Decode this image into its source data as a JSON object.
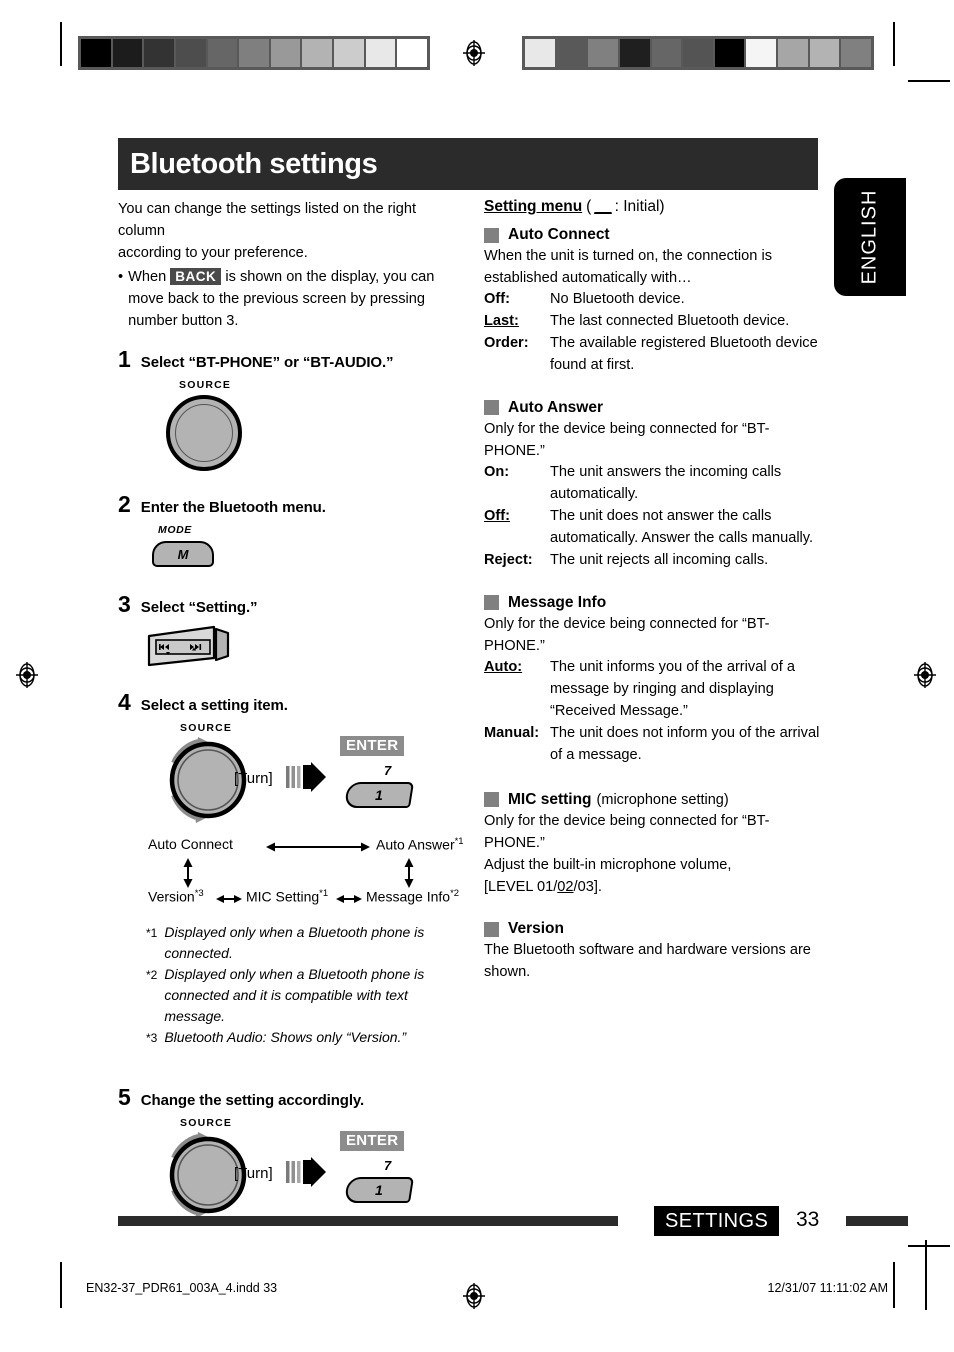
{
  "language_tab": {
    "label": "ENGLISH"
  },
  "page_title": "Bluetooth settings",
  "intro": {
    "line1": "You can change the settings listed on the right column",
    "line2": "according to your preference.",
    "bullet_dot": "•",
    "bullet_pre": "When",
    "bullet_badge": "BACK",
    "bullet_post": "is shown on the display, you can move back to the previous screen by pressing number button 3."
  },
  "steps": [
    {
      "num": "1",
      "text": "Select “BT-PHONE” or “BT-AUDIO.”"
    },
    {
      "num": "2",
      "text": "Enter the Bluetooth menu."
    },
    {
      "num": "3",
      "text": "Select “Setting.”"
    },
    {
      "num": "4",
      "text": "Select a setting item."
    },
    {
      "num": "5",
      "text": "Change the setting accordingly."
    }
  ],
  "controls": {
    "source_label": "SOURCE",
    "mode_label": "MODE",
    "mode_button": "M",
    "turn_label": "[Turn]",
    "enter_badge": "ENTER",
    "number_key": "1",
    "number_key_sup": "7",
    "track_prev_icon": "track-previous-icon",
    "track_next_icon": "track-next-icon"
  },
  "flow": {
    "item1": "Auto Connect",
    "item2": "Auto Answer",
    "item2_sup": "*1",
    "item3": "Message Info",
    "item3_sup": "*2",
    "item4": "MIC Setting",
    "item4_sup": "*1",
    "item5": "Version",
    "item5_sup": "*3"
  },
  "footnotes": [
    {
      "mark": "*1",
      "text": "Displayed only when a Bluetooth phone is connected."
    },
    {
      "mark": "*2",
      "text": "Displayed only when a Bluetooth phone is connected and it is compatible with text message."
    },
    {
      "mark": "*3",
      "text": "Bluetooth Audio: Shows only “Version.”"
    }
  ],
  "setting_menu": {
    "heading": "Setting menu",
    "heading_note_open": "(",
    "heading_note_underline": "__",
    "heading_note_rest": ": Initial)"
  },
  "sections": [
    {
      "name": "Auto Connect",
      "paren": "",
      "intro": "When the unit is turned on, the connection is established automatically with…",
      "options": [
        {
          "key": "Off:",
          "initial": false,
          "desc": "No Bluetooth device."
        },
        {
          "key": "Last:",
          "initial": true,
          "desc": "The last connected Bluetooth device."
        },
        {
          "key": "Order:",
          "initial": false,
          "desc": "The available registered Bluetooth device found at first."
        }
      ]
    },
    {
      "name": "Auto Answer",
      "paren": "",
      "intro": "Only for the device being connected for “BT-PHONE.”",
      "options": [
        {
          "key": "On:",
          "initial": false,
          "desc": "The unit answers the incoming calls automatically."
        },
        {
          "key": "Off:",
          "initial": true,
          "desc": "The unit does not answer the calls automatically. Answer the calls manually."
        },
        {
          "key": "Reject:",
          "initial": false,
          "desc": "The unit rejects all incoming calls."
        }
      ]
    },
    {
      "name": "Message Info",
      "paren": "",
      "intro": "Only for the device being connected for “BT-PHONE.”",
      "options": [
        {
          "key": "Auto:",
          "initial": true,
          "desc": "The unit informs you of the arrival of a message by ringing and displaying “Received Message.”"
        },
        {
          "key": "Manual:",
          "initial": false,
          "desc": "The unit does not inform you of the arrival of a message."
        }
      ]
    }
  ],
  "mic_section": {
    "name": "MIC setting",
    "paren": "(microphone setting)",
    "line1": "Only for the device being connected for “BT-PHONE.”",
    "line2": "Adjust the built-in microphone volume,",
    "level_prefix": "[LEVEL 01/",
    "level_initial": "02",
    "level_suffix": "/03]."
  },
  "version_section": {
    "name": "Version",
    "text": "The Bluetooth software and hardware versions are shown."
  },
  "footer": {
    "section_badge": "SETTINGS",
    "page_number": "33",
    "filename": "EN32-37_PDR61_003A_4.indd   33",
    "timestamp": "12/31/07   11:11:02 AM"
  },
  "colorbars": {
    "left": [
      "#000000",
      "#1c1c1c",
      "#333333",
      "#4d4d4d",
      "#666666",
      "#7f7f7f",
      "#999999",
      "#b3b3b3",
      "#cccccc",
      "#e8e8e8",
      "#ffffff"
    ],
    "right": [
      "#e8e8e8",
      "#595959",
      "#808080",
      "#1f1f1f",
      "#666666",
      "#545454",
      "#000000",
      "#f5f5f5",
      "#a6a6a6",
      "#b3b3b3",
      "#808080"
    ]
  },
  "accent_colors": {
    "banner": "#2b2b2b",
    "badge": "#4a4a4a",
    "enter_badge": "#8c8c8c",
    "square": "#808080"
  }
}
